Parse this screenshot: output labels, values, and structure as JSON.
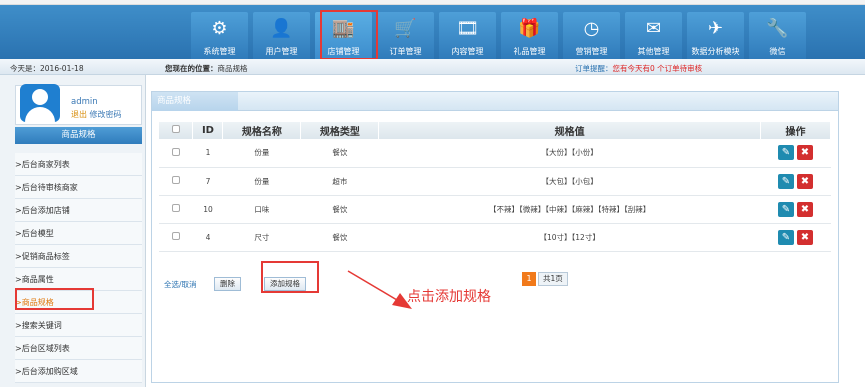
{
  "nav": {
    "items": [
      {
        "label": "系统管理",
        "icon": "gear-icon"
      },
      {
        "label": "用户管理",
        "icon": "user-icon"
      },
      {
        "label": "店铺管理",
        "icon": "shop-icon"
      },
      {
        "label": "订单管理",
        "icon": "cart-icon"
      },
      {
        "label": "内容管理",
        "icon": "film-icon"
      },
      {
        "label": "礼品管理",
        "icon": "gift-icon"
      },
      {
        "label": "营销管理",
        "icon": "clock-icon"
      },
      {
        "label": "其他管理",
        "icon": "mail-icon"
      },
      {
        "label": "数据分析模块",
        "icon": "plane-icon"
      },
      {
        "label": "微信",
        "icon": "wrench-icon"
      }
    ]
  },
  "subbar": {
    "today": "今天是：2016-01-18",
    "location_prefix": "您现在的位置：",
    "location": "商品规格",
    "reminder_prefix": "订单提醒：",
    "reminder": "您有今天有0 个订单待审核"
  },
  "user": {
    "name": "admin",
    "exit": "退出",
    "change_password": "修改密码"
  },
  "sidebar": {
    "title": "商品规格",
    "items": [
      ">后台商家列表",
      ">后台待审核商家",
      ">后台添加店铺",
      ">后台模型",
      ">促销商品标签",
      ">商品属性",
      ">商品规格",
      ">搜索关键词",
      ">后台区域列表",
      ">后台添加购区域"
    ],
    "active_index": 6
  },
  "panel": {
    "tab": "商品规格",
    "headers": [
      "ID",
      "规格名称",
      "规格类型",
      "规格值",
      "操作"
    ],
    "rows": [
      {
        "id": "1",
        "name": "份量",
        "type": "餐饮",
        "values": "【大份】【小份】"
      },
      {
        "id": "7",
        "name": "份量",
        "type": "超市",
        "values": "【大包】【小包】"
      },
      {
        "id": "10",
        "name": "口味",
        "type": "餐饮",
        "values": "【不辣】【微辣】【中辣】【麻辣】【特辣】【刮辣】"
      },
      {
        "id": "4",
        "name": "尺寸",
        "type": "餐饮",
        "values": "【10寸】【12寸】"
      }
    ],
    "select_all": "全选/取消",
    "delete_btn": "删除",
    "add_btn": "添加规格",
    "pager_current": "1",
    "pager_total": "共1页"
  },
  "annotation": {
    "note": "点击添加规格"
  }
}
